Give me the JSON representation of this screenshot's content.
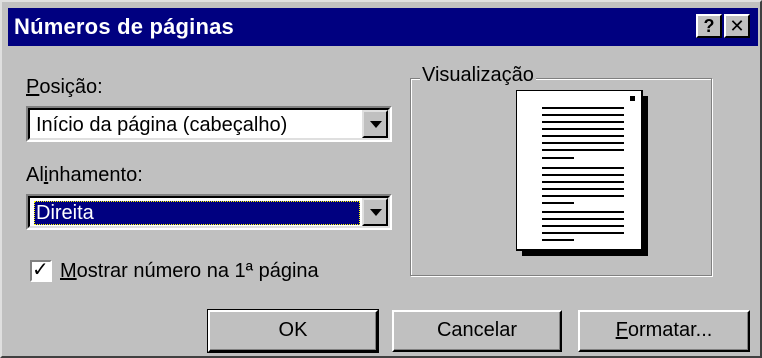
{
  "window": {
    "title": "Números de páginas",
    "help_label": "?",
    "close_label": "✕"
  },
  "position": {
    "label_accel": "P",
    "label_rest": "osição:",
    "value": "Início da página (cabeçalho)"
  },
  "alignment": {
    "label_pre": "Al",
    "label_accel": "i",
    "label_rest": "nhamento:",
    "value": "Direita"
  },
  "show_first_page": {
    "checked": true,
    "check_glyph": "✓",
    "label_accel": "M",
    "label_rest": "ostrar número na 1ª página"
  },
  "preview": {
    "group_title": "Visualização"
  },
  "buttons": {
    "ok": "OK",
    "cancel": "Cancelar",
    "format_accel": "F",
    "format_rest": "ormatar..."
  }
}
